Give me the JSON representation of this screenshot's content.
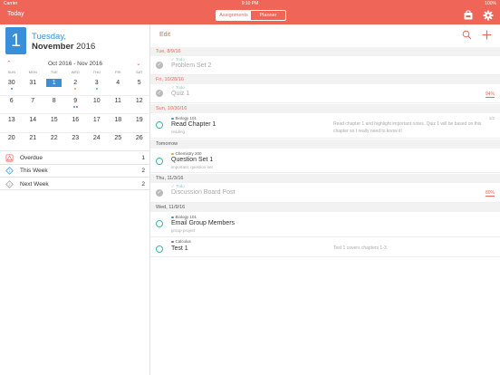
{
  "status_bar": {
    "carrier": "Carrier",
    "time": "9:10 PM",
    "battery": "100%"
  },
  "nav": {
    "today_label": "Today",
    "segments": [
      {
        "label": "Assignments",
        "active": true
      },
      {
        "label": "Planner",
        "active": false
      }
    ],
    "icons": [
      "backpack-icon",
      "settings-gear-icon"
    ],
    "accent": "#ef6558"
  },
  "date_header": {
    "day_number": "1",
    "weekday": "Tuesday,",
    "month": "November",
    "year": "2016",
    "accent": "#3a8fd9"
  },
  "calendar": {
    "range_label": "Oct 2016 - Nov 2016",
    "weekdays": [
      "SUN",
      "MON",
      "TUE",
      "WED",
      "THU",
      "FRI",
      "SAT"
    ],
    "weeks": [
      [
        "30",
        "31",
        "1",
        "2",
        "3",
        "4",
        "5"
      ],
      [
        "6",
        "7",
        "8",
        "9",
        "10",
        "11",
        "12"
      ],
      [
        "13",
        "14",
        "15",
        "16",
        "17",
        "18",
        "19"
      ],
      [
        "20",
        "21",
        "22",
        "23",
        "24",
        "25",
        "26"
      ]
    ],
    "selected": "1"
  },
  "summary": [
    {
      "label": "Overdue",
      "count": "1"
    },
    {
      "label": "This Week",
      "count": "2"
    },
    {
      "label": "Next Week",
      "count": "2"
    }
  ],
  "toolbar": {
    "edit_label": "Edit"
  },
  "sections": [
    {
      "label": "Tue, 8/9/16",
      "red": true
    },
    {
      "label": "Fri, 10/28/16",
      "red": true
    },
    {
      "label": "Sun, 10/30/16",
      "red": true
    },
    {
      "label": "Tomorrow",
      "red": false
    },
    {
      "label": "Thu, 11/3/16",
      "red": false
    },
    {
      "label": "Wed, 11/9/16",
      "red": false
    }
  ],
  "tasks": [
    {
      "course": "Todo",
      "title": "Problem Set 2",
      "done": true
    },
    {
      "course": "Todo",
      "title": "Quiz 1",
      "done": true,
      "grade": "94%"
    },
    {
      "course": "Biology 101",
      "title": "Read Chapter 1",
      "sub": "reading",
      "done": false,
      "note": "Read chapter 1 and highlight important notes. Quiz 1 will be based on this chapter so I really need to know it!",
      "sched": "1/2",
      "course_color": "#3a8fd9"
    },
    {
      "course": "Chemistry 200",
      "title": "Question Set 1",
      "sub": "important, question-set",
      "done": false,
      "course_color": "#f0a030"
    },
    {
      "course": "Todo",
      "title": "Discussion Board Post",
      "done": true,
      "grade": "80%"
    },
    {
      "course": "Biology 101",
      "title": "Email Group Members",
      "sub": "group-project",
      "done": false,
      "course_color": "#3a8fd9"
    },
    {
      "course": "Calculus",
      "title": "Test 1",
      "done": false,
      "note": "Test 1 covers chapters 1-3.",
      "course_color": "#9b59b6"
    }
  ]
}
